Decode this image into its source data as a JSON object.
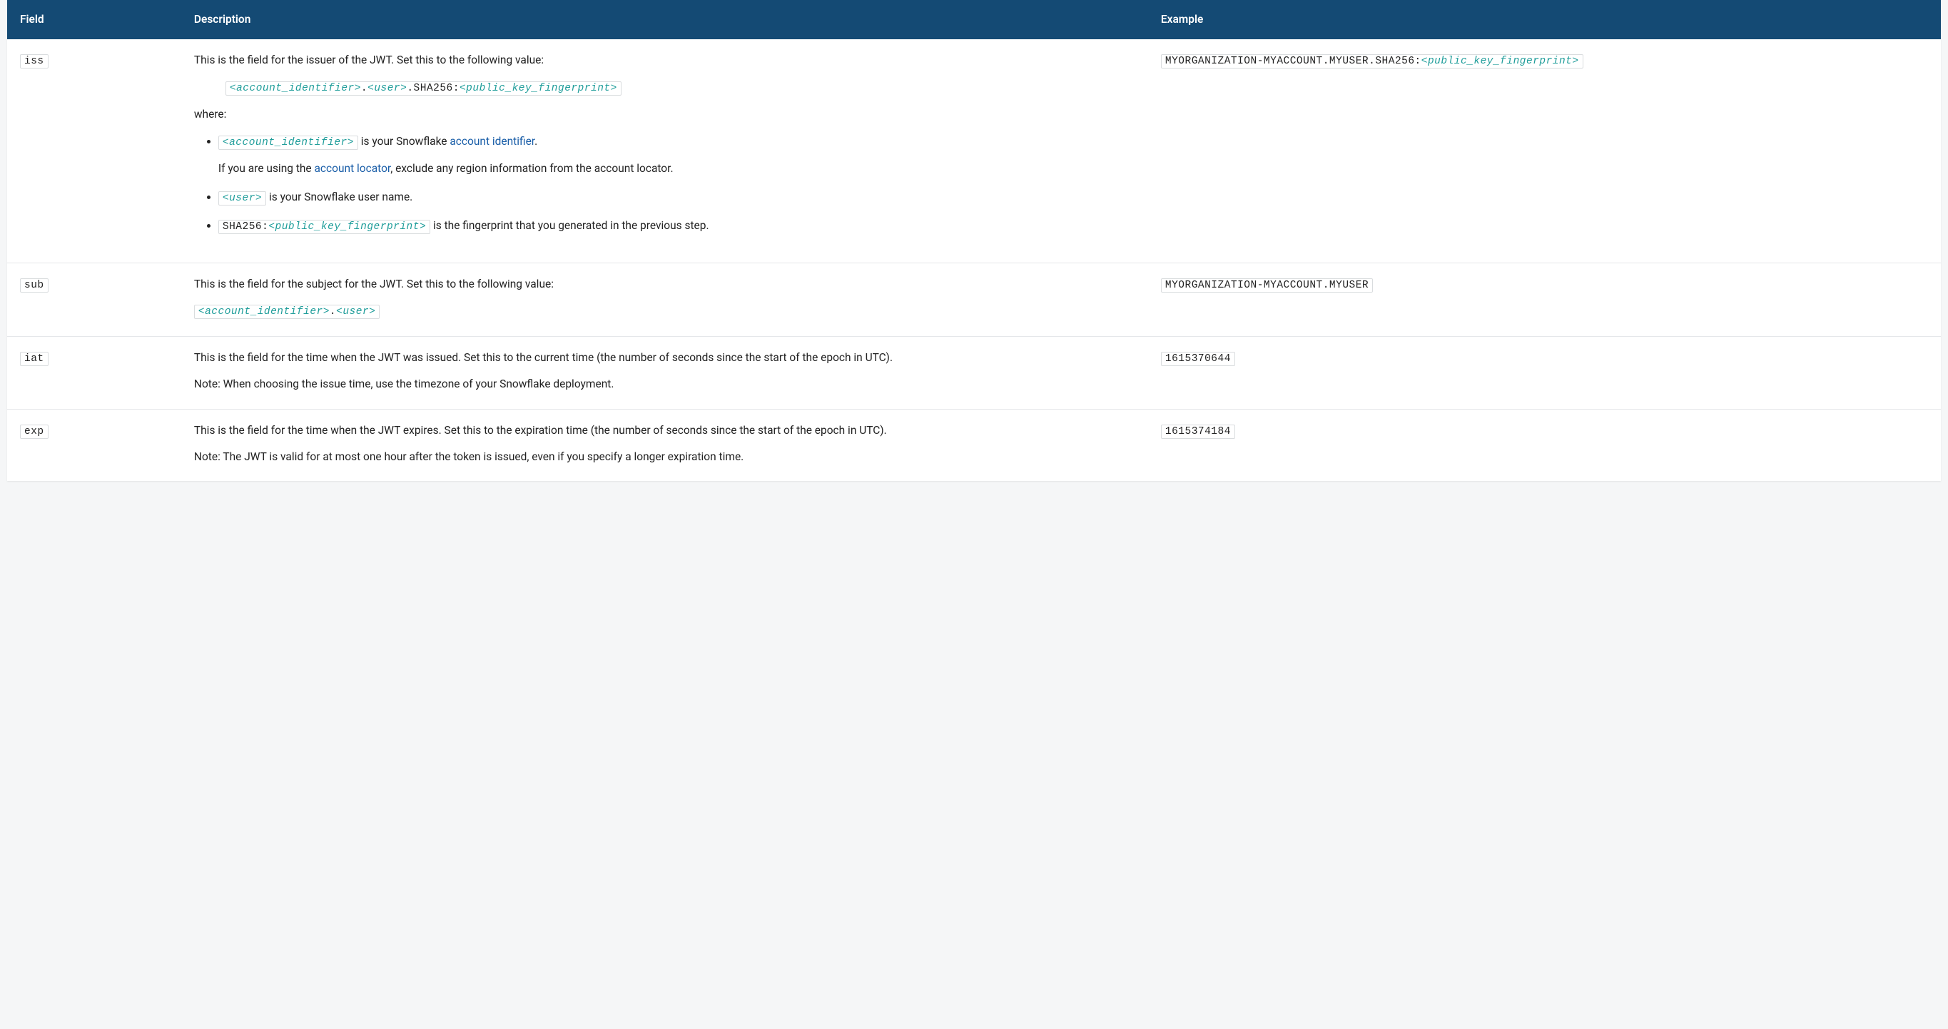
{
  "headers": {
    "field": "Field",
    "description": "Description",
    "example": "Example"
  },
  "rows": {
    "iss": {
      "field": "iss",
      "desc_intro": "This is the field for the issuer of the JWT. Set this to the following value:",
      "code_ai": "<account_identifier>",
      "code_dot1": ".",
      "code_user": "<user>",
      "code_sha_prefix": ".SHA256:",
      "code_pkf": "<public_key_fingerprint>",
      "where": "where:",
      "li1_code": "<account_identifier>",
      "li1_before": " is your Snowflake ",
      "li1_link": "account identifier",
      "li1_after": ".",
      "li1_p2_before": "If you are using the ",
      "li1_p2_link": "account locator",
      "li1_p2_after": ", exclude any region information from the account locator.",
      "li2_code": "<user>",
      "li2_text": " is your Snowflake user name.",
      "li3_code_prefix": "SHA256:",
      "li3_code_ph": "<public_key_fingerprint>",
      "li3_text": " is the fingerprint that you generated in the previous step.",
      "example_plain": "MYORGANIZATION-MYACCOUNT.MYUSER.SHA256:",
      "example_ph": "<public_key_fingerprint>"
    },
    "sub": {
      "field": "sub",
      "desc_intro": "This is the field for the subject for the JWT. Set this to the following value:",
      "code_ai": "<account_identifier>",
      "code_dot": ".",
      "code_user": "<user>",
      "example": "MYORGANIZATION-MYACCOUNT.MYUSER"
    },
    "iat": {
      "field": "iat",
      "desc_p1": "This is the field for the time when the JWT was issued. Set this to the current time (the number of seconds since the start of the epoch in UTC).",
      "desc_p2": "Note: When choosing the issue time, use the timezone of your Snowflake deployment.",
      "example": "1615370644"
    },
    "exp": {
      "field": "exp",
      "desc_p1": "This is the field for the time when the JWT expires. Set this to the expiration time (the number of seconds since the start of the epoch in UTC).",
      "desc_p2": "Note: The JWT is valid for at most one hour after the token is issued, even if you specify a longer expiration time.",
      "example": "1615374184"
    }
  }
}
